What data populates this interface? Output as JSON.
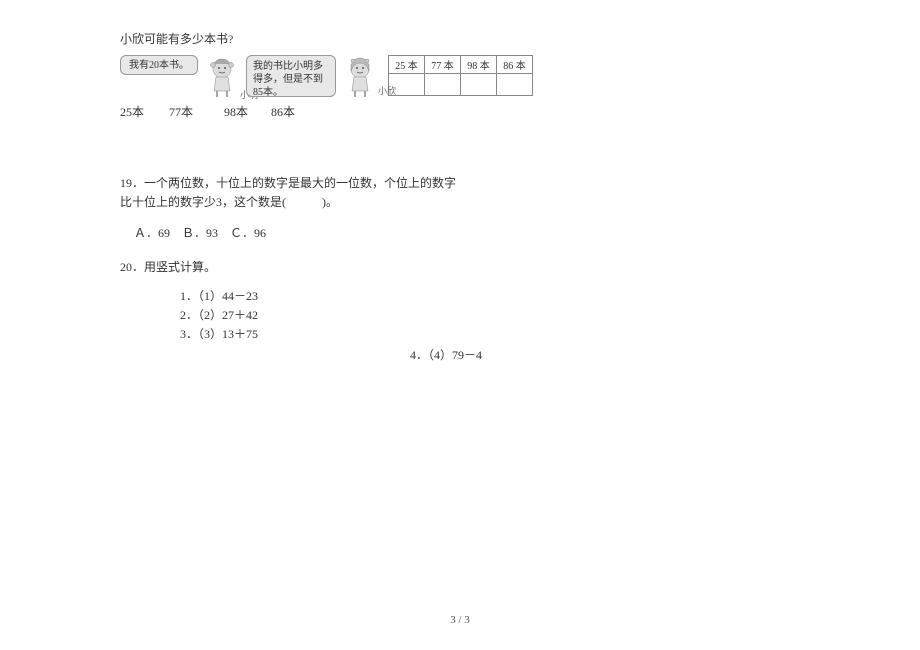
{
  "q18": {
    "title": "小欣可能有多少本书?",
    "bubble1": "我有20本书。",
    "char1_label": "小明",
    "bubble2": "我的书比小明多得多，但是不到85本。",
    "char2_label": "小欣",
    "table": [
      "25 本",
      "77 本",
      "98 本",
      "86 本"
    ],
    "options": [
      "25本",
      "77本",
      "98本",
      "86本"
    ]
  },
  "q19": {
    "line1": "19．一个两位数，十位上的数字是最大的一位数，个位上的数字",
    "line2": "比十位上的数字少3，这个数是(　　　)。",
    "choices": "Ａ．69　Ｂ．93　Ｃ．96"
  },
  "q20": {
    "title": "20．用竖式计算。",
    "items": [
      "1．（1）44－23",
      "2．（2）27＋42",
      "3．（3）13＋75",
      "4．（4）79－4"
    ]
  },
  "page_number": "3 / 3"
}
